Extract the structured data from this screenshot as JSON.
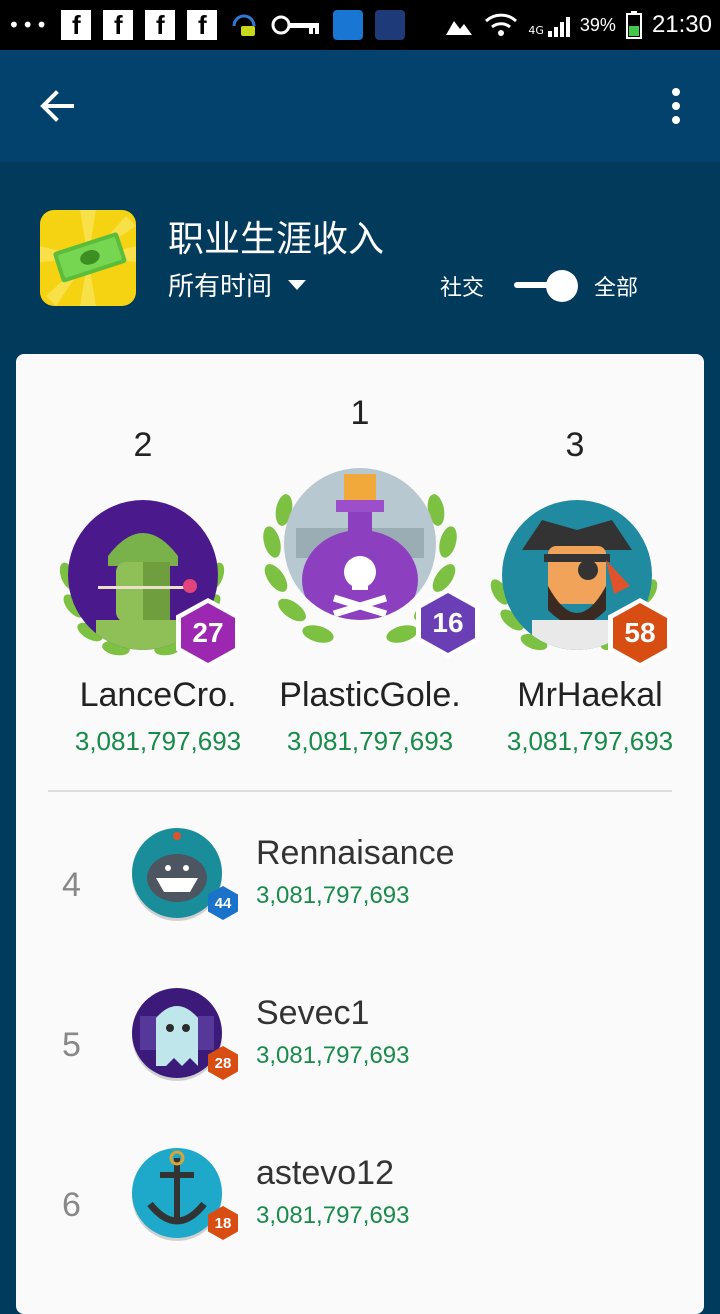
{
  "statusbar": {
    "battery": "39%",
    "time": "21:30",
    "network": "4G",
    "left_icons": [
      "more-dots-icon",
      "facebook-icon",
      "facebook-icon",
      "facebook-icon",
      "facebook-icon",
      "headset-chat-icon",
      "key-icon",
      "app-icon",
      "weather-icon"
    ]
  },
  "appbar": {
    "back_icon": "arrow-left-icon",
    "menu_icon": "more-vert-icon"
  },
  "header": {
    "title": "职业生涯收入",
    "time_filter": "所有时间",
    "toggle_left_label": "社交",
    "toggle_right_label": "全部",
    "toggle_state": "全部"
  },
  "podium": [
    {
      "rank": "2",
      "name": "LanceCro.",
      "score": "3,081,797,693",
      "level": "27",
      "badge_color": "#9c27b0",
      "avatar_bg": "#4a1a8c"
    },
    {
      "rank": "1",
      "name": "PlasticGole.",
      "score": "3,081,797,693",
      "level": "16",
      "badge_color": "#6a3fb5",
      "avatar_bg": "#b8c8d0"
    },
    {
      "rank": "3",
      "name": "MrHaekal",
      "score": "3,081,797,693",
      "level": "58",
      "badge_color": "#d84e12",
      "avatar_bg": "#1f8aa0"
    }
  ],
  "rows": [
    {
      "rank": "4",
      "name": "Rennaisance",
      "score": "3,081,797,693",
      "level": "44",
      "badge_color": "#1a73c8",
      "avatar_bg": "#1a8d9a"
    },
    {
      "rank": "5",
      "name": "Sevec1",
      "score": "3,081,797,693",
      "level": "28",
      "badge_color": "#d84e12",
      "avatar_bg": "#3b1a7a"
    },
    {
      "rank": "6",
      "name": "astevo12",
      "score": "3,081,797,693",
      "level": "18",
      "badge_color": "#d84e12",
      "avatar_bg": "#1ea8c9"
    }
  ],
  "colors": {
    "score_green": "#188a4a",
    "appbar": "#02426d",
    "background": "#003a5c"
  }
}
